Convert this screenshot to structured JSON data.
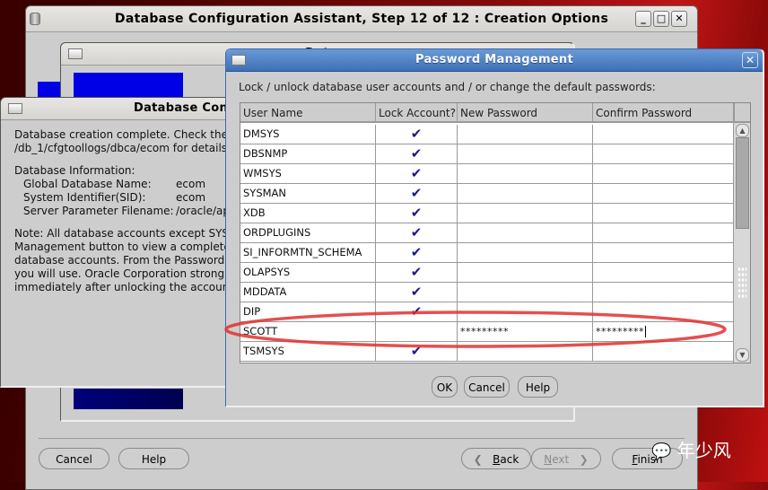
{
  "main_window": {
    "title": "Database Configuration Assistant, Step 12 of 12 : Creation Options",
    "buttons": {
      "minimize": "_",
      "maximize": "□",
      "close": "✕"
    },
    "footer": {
      "cancel": "Cancel",
      "help": "Help",
      "back": "Back",
      "next": "Next",
      "finish": "Finish"
    }
  },
  "progress_window": {
    "title_partial": "Dat"
  },
  "summary_window": {
    "title_partial": "Database Con",
    "lines": [
      "Database creation complete. Check the lo",
      "/db_1/cfgtoollogs/dbca/ecom for details"
    ],
    "info_heading": "Database Information:",
    "info": [
      {
        "label": "Global Database Name:",
        "value": "ecom"
      },
      {
        "label": "System Identifier(SID):",
        "value": "ecom"
      },
      {
        "label": "Server Parameter Filename:",
        "value": "/oracle/ap"
      }
    ],
    "note_lines": [
      "Note: All database accounts except SYS a",
      "Management button to view a complete li",
      "database accounts. From the Password M",
      "you will use. Oracle Corporation strongly",
      "immediately after unlocking the account."
    ]
  },
  "password_dialog": {
    "title": "Password Management",
    "close": "✕",
    "instructions": "Lock / unlock database user accounts and / or change the default passwords:",
    "columns": [
      "User Name",
      "Lock Account?",
      "New Password",
      "Confirm Password"
    ],
    "rows": [
      {
        "user": "DMSYS",
        "locked": "✔",
        "new_password": "",
        "confirm_password": ""
      },
      {
        "user": "DBSNMP",
        "locked": "✔",
        "new_password": "",
        "confirm_password": ""
      },
      {
        "user": "WMSYS",
        "locked": "✔",
        "new_password": "",
        "confirm_password": ""
      },
      {
        "user": "SYSMAN",
        "locked": "✔",
        "new_password": "",
        "confirm_password": ""
      },
      {
        "user": "XDB",
        "locked": "✔",
        "new_password": "",
        "confirm_password": ""
      },
      {
        "user": "ORDPLUGINS",
        "locked": "✔",
        "new_password": "",
        "confirm_password": ""
      },
      {
        "user": "SI_INFORMTN_SCHEMA",
        "locked": "✔",
        "new_password": "",
        "confirm_password": ""
      },
      {
        "user": "OLAPSYS",
        "locked": "✔",
        "new_password": "",
        "confirm_password": ""
      },
      {
        "user": "MDDATA",
        "locked": "✔",
        "new_password": "",
        "confirm_password": ""
      },
      {
        "user": "DIP",
        "locked": "✔",
        "new_password": "",
        "confirm_password": ""
      },
      {
        "user": "SCOTT",
        "locked": "",
        "new_password": "*********",
        "confirm_password": "*********"
      },
      {
        "user": "TSMSYS",
        "locked": "✔",
        "new_password": "",
        "confirm_password": ""
      }
    ],
    "buttons": {
      "ok": "OK",
      "cancel": "Cancel",
      "help": "Help"
    }
  },
  "annotation": {
    "highlight_color": "#e03030",
    "highlighted_row": "SCOTT"
  },
  "watermark": "年少风"
}
